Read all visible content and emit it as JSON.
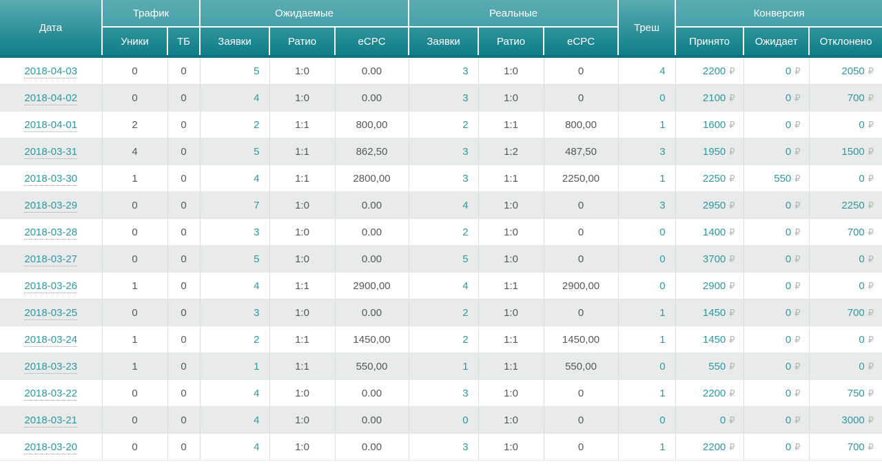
{
  "headers": {
    "date": "Дата",
    "traffic": "Трафик",
    "expected": "Ожидаемые",
    "real": "Реальные",
    "trash": "Треш",
    "conversion": "Конверсия",
    "uniques": "Уники",
    "tb": "ТБ",
    "leads": "Заявки",
    "ratio": "Ратио",
    "ecpc": "eCPC",
    "accepted": "Принято",
    "pending": "Ожидает",
    "rejected": "Отклонено"
  },
  "currency": "₽",
  "colors": {
    "accent_teal": "#2c99a1",
    "header_teal_light": "#5aacb2",
    "header_teal_dark": "#0f7d88",
    "header_bottom_strip": "#0b747e",
    "row_alt_background": "#e9ebeb",
    "ruble_gray": "#b3b6b8"
  },
  "rows": [
    {
      "date": "2018-04-03",
      "uniques": "0",
      "tb": "0",
      "exp_leads": "5",
      "exp_ratio": "1:0",
      "exp_ecpc": "0.00",
      "real_leads": "3",
      "real_ratio": "1:0",
      "real_ecpc": "0",
      "trash": "4",
      "accepted": "2200",
      "pending": "0",
      "rejected": "2050"
    },
    {
      "date": "2018-04-02",
      "uniques": "0",
      "tb": "0",
      "exp_leads": "4",
      "exp_ratio": "1:0",
      "exp_ecpc": "0.00",
      "real_leads": "3",
      "real_ratio": "1:0",
      "real_ecpc": "0",
      "trash": "0",
      "accepted": "2100",
      "pending": "0",
      "rejected": "700"
    },
    {
      "date": "2018-04-01",
      "uniques": "2",
      "tb": "0",
      "exp_leads": "2",
      "exp_ratio": "1:1",
      "exp_ecpc": "800,00",
      "real_leads": "2",
      "real_ratio": "1:1",
      "real_ecpc": "800,00",
      "trash": "1",
      "accepted": "1600",
      "pending": "0",
      "rejected": "0"
    },
    {
      "date": "2018-03-31",
      "uniques": "4",
      "tb": "0",
      "exp_leads": "5",
      "exp_ratio": "1:1",
      "exp_ecpc": "862,50",
      "real_leads": "3",
      "real_ratio": "1:2",
      "real_ecpc": "487,50",
      "trash": "3",
      "accepted": "1950",
      "pending": "0",
      "rejected": "1500"
    },
    {
      "date": "2018-03-30",
      "uniques": "1",
      "tb": "0",
      "exp_leads": "4",
      "exp_ratio": "1:1",
      "exp_ecpc": "2800,00",
      "real_leads": "3",
      "real_ratio": "1:1",
      "real_ecpc": "2250,00",
      "trash": "1",
      "accepted": "2250",
      "pending": "550",
      "rejected": "0"
    },
    {
      "date": "2018-03-29",
      "uniques": "0",
      "tb": "0",
      "exp_leads": "7",
      "exp_ratio": "1:0",
      "exp_ecpc": "0.00",
      "real_leads": "4",
      "real_ratio": "1:0",
      "real_ecpc": "0",
      "trash": "3",
      "accepted": "2950",
      "pending": "0",
      "rejected": "2250"
    },
    {
      "date": "2018-03-28",
      "uniques": "0",
      "tb": "0",
      "exp_leads": "3",
      "exp_ratio": "1:0",
      "exp_ecpc": "0.00",
      "real_leads": "2",
      "real_ratio": "1:0",
      "real_ecpc": "0",
      "trash": "0",
      "accepted": "1400",
      "pending": "0",
      "rejected": "700"
    },
    {
      "date": "2018-03-27",
      "uniques": "0",
      "tb": "0",
      "exp_leads": "5",
      "exp_ratio": "1:0",
      "exp_ecpc": "0.00",
      "real_leads": "5",
      "real_ratio": "1:0",
      "real_ecpc": "0",
      "trash": "0",
      "accepted": "3700",
      "pending": "0",
      "rejected": "0"
    },
    {
      "date": "2018-03-26",
      "uniques": "1",
      "tb": "0",
      "exp_leads": "4",
      "exp_ratio": "1:1",
      "exp_ecpc": "2900,00",
      "real_leads": "4",
      "real_ratio": "1:1",
      "real_ecpc": "2900,00",
      "trash": "0",
      "accepted": "2900",
      "pending": "0",
      "rejected": "0"
    },
    {
      "date": "2018-03-25",
      "uniques": "0",
      "tb": "0",
      "exp_leads": "3",
      "exp_ratio": "1:0",
      "exp_ecpc": "0.00",
      "real_leads": "2",
      "real_ratio": "1:0",
      "real_ecpc": "0",
      "trash": "1",
      "accepted": "1450",
      "pending": "0",
      "rejected": "700"
    },
    {
      "date": "2018-03-24",
      "uniques": "1",
      "tb": "0",
      "exp_leads": "2",
      "exp_ratio": "1:1",
      "exp_ecpc": "1450,00",
      "real_leads": "2",
      "real_ratio": "1:1",
      "real_ecpc": "1450,00",
      "trash": "1",
      "accepted": "1450",
      "pending": "0",
      "rejected": "0"
    },
    {
      "date": "2018-03-23",
      "uniques": "1",
      "tb": "0",
      "exp_leads": "1",
      "exp_ratio": "1:1",
      "exp_ecpc": "550,00",
      "real_leads": "1",
      "real_ratio": "1:1",
      "real_ecpc": "550,00",
      "trash": "0",
      "accepted": "550",
      "pending": "0",
      "rejected": "0"
    },
    {
      "date": "2018-03-22",
      "uniques": "0",
      "tb": "0",
      "exp_leads": "4",
      "exp_ratio": "1:0",
      "exp_ecpc": "0.00",
      "real_leads": "3",
      "real_ratio": "1:0",
      "real_ecpc": "0",
      "trash": "1",
      "accepted": "2200",
      "pending": "0",
      "rejected": "750"
    },
    {
      "date": "2018-03-21",
      "uniques": "0",
      "tb": "0",
      "exp_leads": "4",
      "exp_ratio": "1:0",
      "exp_ecpc": "0.00",
      "real_leads": "0",
      "real_ratio": "1:0",
      "real_ecpc": "0",
      "trash": "0",
      "accepted": "0",
      "pending": "0",
      "rejected": "3000"
    },
    {
      "date": "2018-03-20",
      "uniques": "0",
      "tb": "0",
      "exp_leads": "4",
      "exp_ratio": "1:0",
      "exp_ecpc": "0.00",
      "real_leads": "3",
      "real_ratio": "1:0",
      "real_ecpc": "0",
      "trash": "1",
      "accepted": "2200",
      "pending": "0",
      "rejected": "700"
    }
  ]
}
